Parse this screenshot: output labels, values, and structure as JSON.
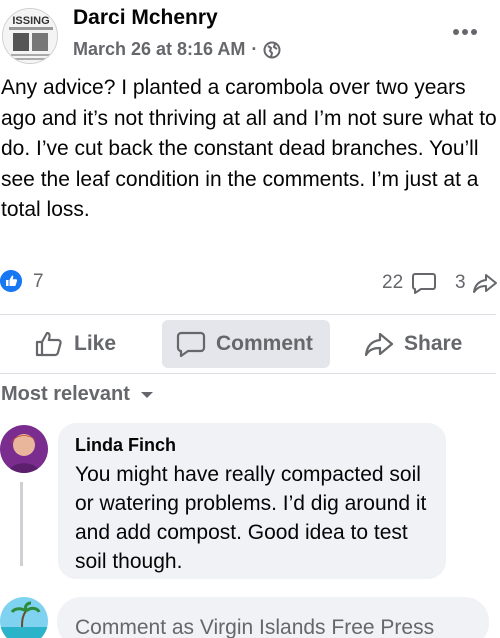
{
  "post": {
    "author": "Darci Mchenry",
    "timestamp": "March 26 at 8:16 AM",
    "separator": "·",
    "audience_icon": "globe-icon",
    "avatar_text": "ISSING",
    "body": "Any advice? I planted a carombola over two years ago and it’s not thriving at all and I’m not sure what to do. I’ve cut back the constant dead branches. You’ll see the leaf condition in the comments. I’m just at a total loss."
  },
  "reactions": {
    "likes": "7",
    "comments": "22",
    "shares": "3",
    "like_color": "#1877f2"
  },
  "actions": {
    "like": "Like",
    "comment": "Comment",
    "share": "Share"
  },
  "sort": {
    "label": "Most relevant"
  },
  "comments": [
    {
      "author": "Linda Finch",
      "text": "You might have really compacted soil or watering problems. I’d dig around it and add compost. Good idea to test soil though."
    }
  ],
  "composer": {
    "placeholder": "Comment as Virgin Islands Free Press"
  },
  "colors": {
    "secondary_text": "#65676b",
    "bubble": "#f0f2f5",
    "accent": "#1877f2"
  }
}
